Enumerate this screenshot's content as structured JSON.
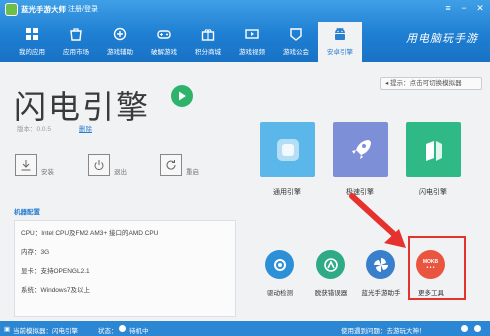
{
  "app": {
    "title": "蓝光手游大师",
    "login": "注册/登录"
  },
  "nav": [
    {
      "label": "我的应用",
      "icon": "apps-icon"
    },
    {
      "label": "应用市场",
      "icon": "market-icon"
    },
    {
      "label": "游戏辅助",
      "icon": "game-assist-icon"
    },
    {
      "label": "破解游戏",
      "icon": "crack-game-icon"
    },
    {
      "label": "积分商城",
      "icon": "points-mall-icon"
    },
    {
      "label": "游戏视频",
      "icon": "video-icon"
    },
    {
      "label": "游戏公会",
      "icon": "guild-icon"
    },
    {
      "label": "安卓引擎",
      "icon": "android-icon",
      "active": true
    }
  ],
  "brand": "用电脑玩手游",
  "hint": "提示：点击可切换模拟器",
  "engine": {
    "name": "闪电引擎",
    "version": "版本：0.0.5",
    "delete_label": "删除"
  },
  "controls": {
    "install": "安装",
    "exit": "退出",
    "restart": "重启"
  },
  "config": {
    "title": "机器配置",
    "lines": [
      "CPU：Intel CPU及FM2 AM3+ 接口的AMD CPU",
      "内存：3G",
      "显卡：支持OPENGL2.1",
      "系统：Windows7及以上"
    ]
  },
  "engines": [
    {
      "label": "通用引擎",
      "color": "#5bb6e9"
    },
    {
      "label": "极速引擎",
      "color": "#7d8fd7"
    },
    {
      "label": "闪电引擎",
      "color": "#2fb986"
    }
  ],
  "tools": [
    {
      "label": "驱动检测",
      "color": "#2d8fd6",
      "icon": "driver-check-icon"
    },
    {
      "label": "脱获错误器",
      "color": "#2eaa86",
      "icon": "error-catcher-icon"
    },
    {
      "label": "蓝光手游助手",
      "color": "#3a7fcb",
      "icon": "assistant-icon"
    },
    {
      "label": "更多工具",
      "color": "#e9553f",
      "icon": "more-tools-icon",
      "badge": "MOKB"
    }
  ],
  "status": {
    "current": "当前模拟器：闪电引擎",
    "state_label": "状态：",
    "state_value": "待机中",
    "problem": "使用遇到问题：去游玩大神！"
  },
  "colors": {
    "header": "#1f7fd2",
    "accent": "#2a7fcf",
    "highlight": "#e5322e"
  }
}
